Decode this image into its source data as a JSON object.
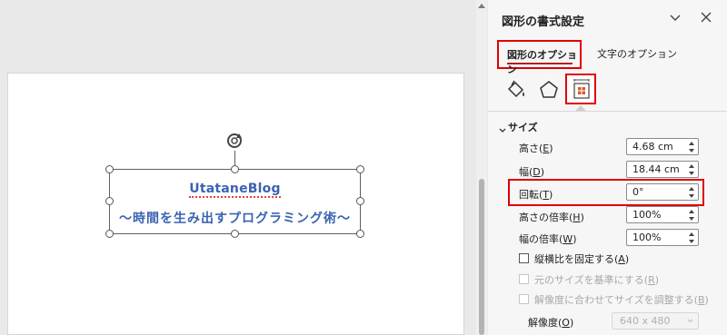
{
  "panel": {
    "title": "図形の書式設定",
    "tabs": {
      "shape_options": "図形のオプション",
      "text_options": "文字のオプション"
    },
    "icons": [
      "fill-line-icon",
      "effects-icon",
      "size-properties-icon"
    ],
    "section": {
      "title": "サイズ"
    },
    "fields": {
      "height": {
        "label_pre": "高さ(",
        "key": "E",
        "label_post": ")",
        "value": "4.68 cm"
      },
      "width": {
        "label_pre": "幅(",
        "key": "D",
        "label_post": ")",
        "value": "18.44 cm"
      },
      "rotation": {
        "label_pre": "回転(",
        "key": "T",
        "label_post": ")",
        "value": "0°"
      },
      "scale_height": {
        "label_pre": "高さの倍率(",
        "key": "H",
        "label_post": ")",
        "value": "100%"
      },
      "scale_width": {
        "label_pre": "幅の倍率(",
        "key": "W",
        "label_post": ")",
        "value": "100%"
      }
    },
    "checkboxes": {
      "lock_aspect": {
        "label_pre": "縦横比を固定する(",
        "key": "A",
        "label_post": ")"
      },
      "relative_original": {
        "label_pre": "元のサイズを基準にする(",
        "key": "R",
        "label_post": ")"
      },
      "best_scale": {
        "label_pre": "解像度に合わせてサイズを調整する(",
        "key": "B",
        "label_post": ")"
      }
    },
    "resolution": {
      "label_pre": "解像度(",
      "key": "O",
      "label_post": ")",
      "value": "640 x 480"
    }
  },
  "slide": {
    "shape_text_line1": "UtataneBlog",
    "shape_text_line2": "〜時間を生み出すプログラミング術〜"
  },
  "colors": {
    "highlight": "#e00000",
    "shape_text": "#3a63b0",
    "panel_bg": "#f6f6f6"
  }
}
